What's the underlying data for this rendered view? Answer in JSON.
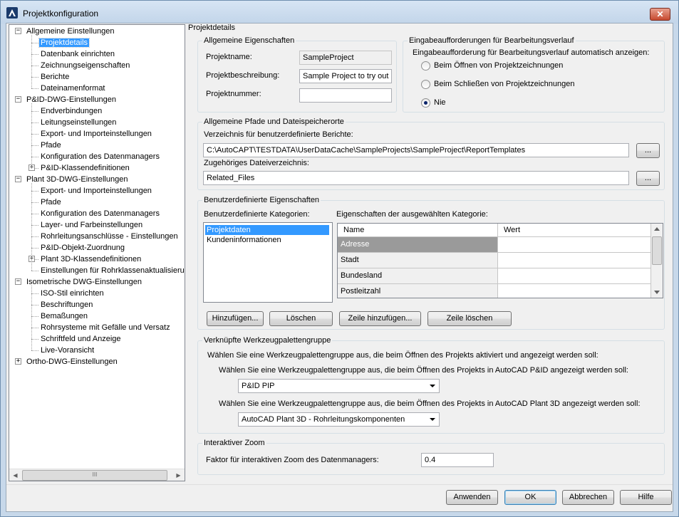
{
  "window": {
    "title": "Projektkonfiguration",
    "close": "✕"
  },
  "tree": [
    {
      "label": "Allgemeine Einstellungen",
      "level": 0,
      "expander": "−"
    },
    {
      "label": "Projektdetails",
      "level": 1,
      "selected": true
    },
    {
      "label": "Datenbank einrichten",
      "level": 1
    },
    {
      "label": "Zeichnungseigenschaften",
      "level": 1
    },
    {
      "label": "Berichte",
      "level": 1
    },
    {
      "label": "Dateinamenformat",
      "level": 1
    },
    {
      "label": "P&ID-DWG-Einstellungen",
      "level": 0,
      "expander": "−"
    },
    {
      "label": "Endverbindungen",
      "level": 1
    },
    {
      "label": "Leitungseinstellungen",
      "level": 1
    },
    {
      "label": "Export- und Importeinstellungen",
      "level": 1
    },
    {
      "label": "Pfade",
      "level": 1
    },
    {
      "label": "Konfiguration des Datenmanagers",
      "level": 1
    },
    {
      "label": "P&ID-Klassendefinitionen",
      "level": 1,
      "expander": "+"
    },
    {
      "label": "Plant 3D-DWG-Einstellungen",
      "level": 0,
      "expander": "−"
    },
    {
      "label": "Export- und Importeinstellungen",
      "level": 1
    },
    {
      "label": "Pfade",
      "level": 1
    },
    {
      "label": "Konfiguration des Datenmanagers",
      "level": 1
    },
    {
      "label": "Layer- und Farbeinstellungen",
      "level": 1
    },
    {
      "label": "Rohrleitungsanschlüsse - Einstellungen",
      "level": 1
    },
    {
      "label": "P&ID-Objekt-Zuordnung",
      "level": 1
    },
    {
      "label": "Plant 3D-Klassendefinitionen",
      "level": 1,
      "expander": "+"
    },
    {
      "label": "Einstellungen für Rohrklassenaktualisierung",
      "level": 1
    },
    {
      "label": "Isometrische DWG-Einstellungen",
      "level": 0,
      "expander": "−"
    },
    {
      "label": "ISO-Stil einrichten",
      "level": 1
    },
    {
      "label": "Beschriftungen",
      "level": 1
    },
    {
      "label": "Bemaßungen",
      "level": 1
    },
    {
      "label": "Rohrsysteme mit Gefälle und Versatz",
      "level": 1
    },
    {
      "label": "Schriftfeld und Anzeige",
      "level": 1
    },
    {
      "label": "Live-Voransicht",
      "level": 1
    },
    {
      "label": "Ortho-DWG-Einstellungen",
      "level": 0,
      "expander": "+"
    }
  ],
  "tree_scroll": {
    "left": "◀",
    "right": "▶",
    "thumb": "III"
  },
  "page_title": "Projektdetails",
  "general": {
    "title": "Allgemeine Eigenschaften",
    "name_label": "Projektname:",
    "name_value": "SampleProject",
    "desc_label": "Projektbeschreibung:",
    "desc_value": "Sample Project to try out P",
    "number_label": "Projektnummer:",
    "number_value": ""
  },
  "prompt": {
    "title": "Eingabeaufforderungen für Bearbeitungsverlauf",
    "question": "Eingabeaufforderung für Bearbeitungsverlauf automatisch anzeigen:",
    "options": [
      {
        "label": "Beim Öffnen von Projektzeichnungen",
        "checked": false
      },
      {
        "label": "Beim Schließen von Projektzeichnungen",
        "checked": false
      },
      {
        "label": "Nie",
        "checked": true
      }
    ]
  },
  "paths": {
    "title": "Allgemeine Pfade und Dateispeicherorte",
    "reports_label": "Verzeichnis für benutzerdefinierte Berichte:",
    "reports_value": "C:\\AutoCAPT\\TESTDATA\\UserDataCache\\SampleProjects\\SampleProject\\ReportTemplates",
    "related_label": "Zugehöriges Dateiverzeichnis:",
    "related_value": "Related_Files",
    "browse": "..."
  },
  "custom": {
    "title": "Benutzerdefinierte Eigenschaften",
    "categories_label": "Benutzerdefinierte Kategorien:",
    "categories": [
      {
        "label": "Projektdaten",
        "selected": true
      },
      {
        "label": "Kundeninformationen",
        "selected": false
      }
    ],
    "props_label": "Eigenschaften der ausgewählten Kategorie:",
    "columns": [
      "Name",
      "Wert"
    ],
    "rows": [
      {
        "name": "Adresse",
        "value": "",
        "selected": true
      },
      {
        "name": "Stadt",
        "value": ""
      },
      {
        "name": "Bundesland",
        "value": ""
      },
      {
        "name": "Postleitzahl",
        "value": ""
      }
    ],
    "add": "Hinzufügen...",
    "delete": "Löschen",
    "add_row": "Zeile hinzufügen...",
    "delete_row": "Zeile löschen"
  },
  "palette": {
    "title": "Verknüpfte Werkzeugpalettengruppe",
    "intro": "Wählen Sie eine Werkzeugpalettengruppe aus, die beim Öffnen des Projekts aktiviert und angezeigt werden soll:",
    "pid_label": "Wählen Sie eine Werkzeugpalettengruppe aus, die beim Öffnen des Projekts in AutoCAD P&ID angezeigt werden soll:",
    "pid_value": "P&ID PIP",
    "plant_label": "Wählen Sie eine Werkzeugpalettengruppe aus, die beim Öffnen des Projekts in AutoCAD Plant 3D angezeigt werden soll:",
    "plant_value": "AutoCAD Plant 3D - Rohrleitungskomponenten"
  },
  "zoom": {
    "title": "Interaktiver Zoom",
    "label": "Faktor für interaktiven Zoom des Datenmanagers:",
    "value": "0.4"
  },
  "footer": {
    "apply": "Anwenden",
    "ok": "OK",
    "cancel": "Abbrechen",
    "help": "Hilfe"
  }
}
